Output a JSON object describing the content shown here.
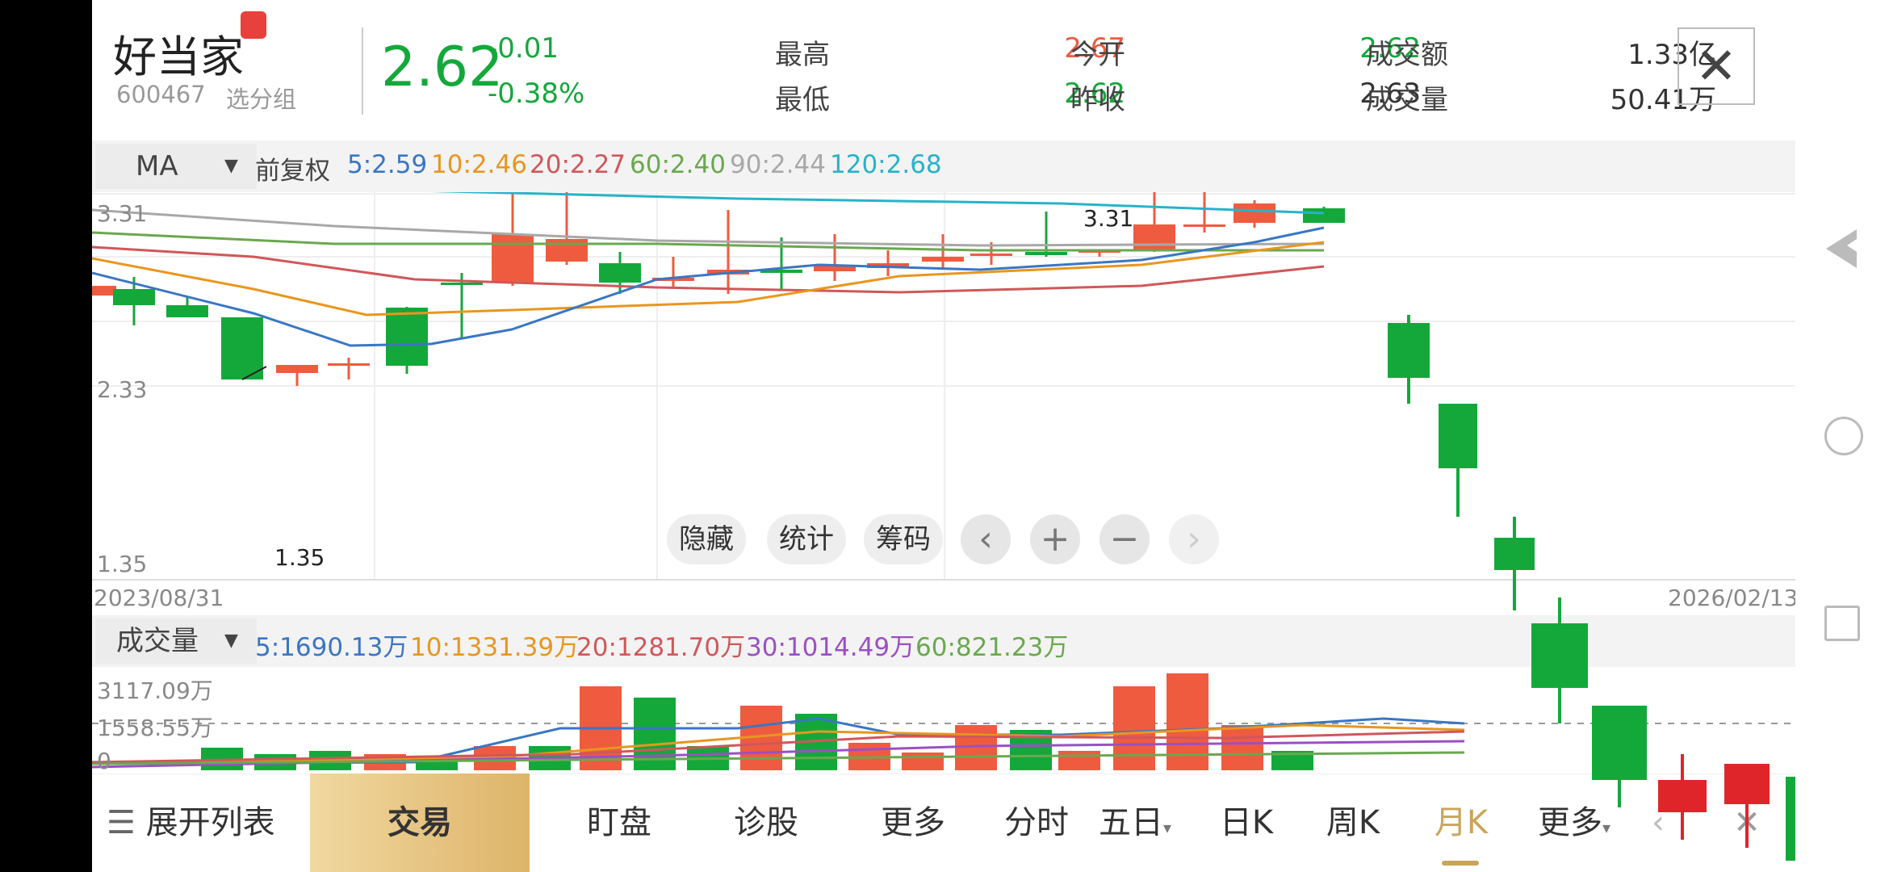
{
  "stock": {
    "name": "好当家",
    "code": "600467",
    "group_label": "选分组",
    "price": "2.62",
    "change": "-0.01",
    "change_pct": "-0.38%",
    "stats": {
      "high_label": "最高",
      "high": "2.67",
      "low_label": "最低",
      "low": "2.62",
      "open_label": "今开",
      "open": "2.62",
      "prev_close_label": "昨收",
      "prev_close": "2.63",
      "amount_label": "成交额",
      "amount": "1.33亿",
      "volume_label": "成交量",
      "volume": "50.41万"
    },
    "close_symbol": "✕"
  },
  "ma_bar": {
    "selector": "MA",
    "adjust": "前复权",
    "items": [
      {
        "text": "5:2.59",
        "color": "#3a76c4"
      },
      {
        "text": "10:2.46",
        "color": "#e8961e"
      },
      {
        "text": "20:2.27",
        "color": "#d0575a"
      },
      {
        "text": "60:2.40",
        "color": "#6aa84f"
      },
      {
        "text": "90:2.44",
        "color": "#a8a8a8"
      },
      {
        "text": "120:2.68",
        "color": "#26b3c9"
      }
    ]
  },
  "price_chart": {
    "y_top": "3.31",
    "y_mid": "2.33",
    "y_bottom": "1.35",
    "high_marker": "3.31",
    "low_marker": "1.35",
    "date_start": "2023/08/31",
    "date_end": "2026/02/13",
    "buttons": {
      "hide": "隐藏",
      "stats": "统计",
      "chips": "筹码"
    },
    "nav": {
      "prev": "‹",
      "zoom_in": "+",
      "zoom_out": "−",
      "next": "›"
    }
  },
  "volume_bar": {
    "selector": "成交量",
    "items": [
      {
        "text": "5:1690.13万",
        "color": "#3a76c4"
      },
      {
        "text": "10:1331.39万",
        "color": "#e8961e"
      },
      {
        "text": "20:1281.70万",
        "color": "#d0575a"
      },
      {
        "text": "30:1014.49万",
        "color": "#9b4fc4"
      },
      {
        "text": "60:821.23万",
        "color": "#6aa84f"
      }
    ],
    "y_top": "3117.09万",
    "y_mid": "1558.55万",
    "y_zero": "0"
  },
  "tabs": {
    "expand": "展开列表",
    "trade": "交易",
    "watch": "盯盘",
    "diagnose": "诊股",
    "more1": "更多",
    "intraday": "分时",
    "five_day": "五日",
    "daily": "日K",
    "weekly": "周K",
    "monthly": "月K",
    "more2": "更多"
  },
  "colors": {
    "up": "#ef5b3f",
    "down": "#14a83b",
    "accent": "#c9a45a",
    "trade_tab": "#e3c07e"
  }
}
